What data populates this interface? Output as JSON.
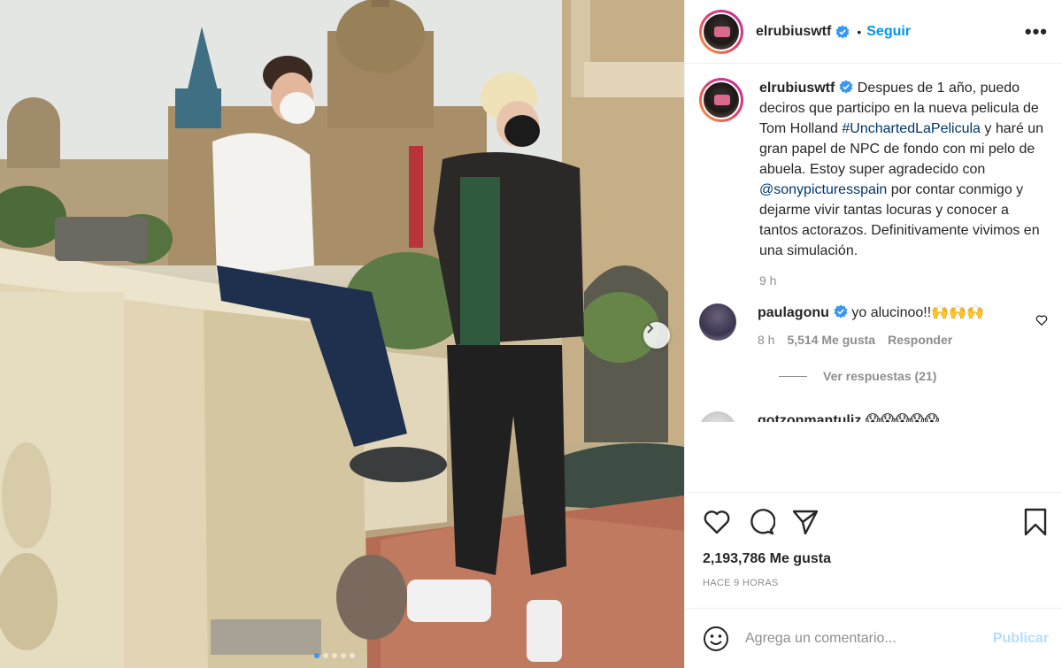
{
  "post": {
    "username": "elrubiuswtf",
    "follow_label": "Seguir",
    "more_label": "•••",
    "separator": "•",
    "caption": {
      "username": "elrubiuswtf",
      "text_1": "Despues de 1 año, puedo deciros que participo en la nueva pelicula de Tom Holland ",
      "hashtag": "#UnchartedLaPelicula",
      "text_2": " y haré un gran papel de NPC de fondo con mi pelo de abuela. Estoy super agradecido con ",
      "mention": "@sonypicturesspain",
      "text_3": " por contar conmigo y dejarme vivir tantas locuras y conocer a tantos actorazos. Definitivamente vivimos en una simulación.",
      "time": "9 h"
    },
    "comments": [
      {
        "username": "paulagonu",
        "text": "yo alucinoo!!🙌🙌🙌",
        "time": "8 h",
        "likes": "5,514 Me gusta",
        "reply_label": "Responder",
        "view_replies": "Ver respuestas (21)"
      },
      {
        "username": "gotzonmantuliz",
        "text": "😱😱😱😱😱"
      }
    ],
    "likes_count": "2,193,786 Me gusta",
    "posted_ago": "HACE 9 HORAS",
    "comment_placeholder": "Agrega un comentario...",
    "publish_label": "Publicar",
    "carousel": {
      "slides": 5,
      "active": 1
    }
  },
  "colors": {
    "accent": "#0095f6",
    "link": "#00376b",
    "muted": "#8e8e8e",
    "publish_disabled": "#b2dffc"
  }
}
